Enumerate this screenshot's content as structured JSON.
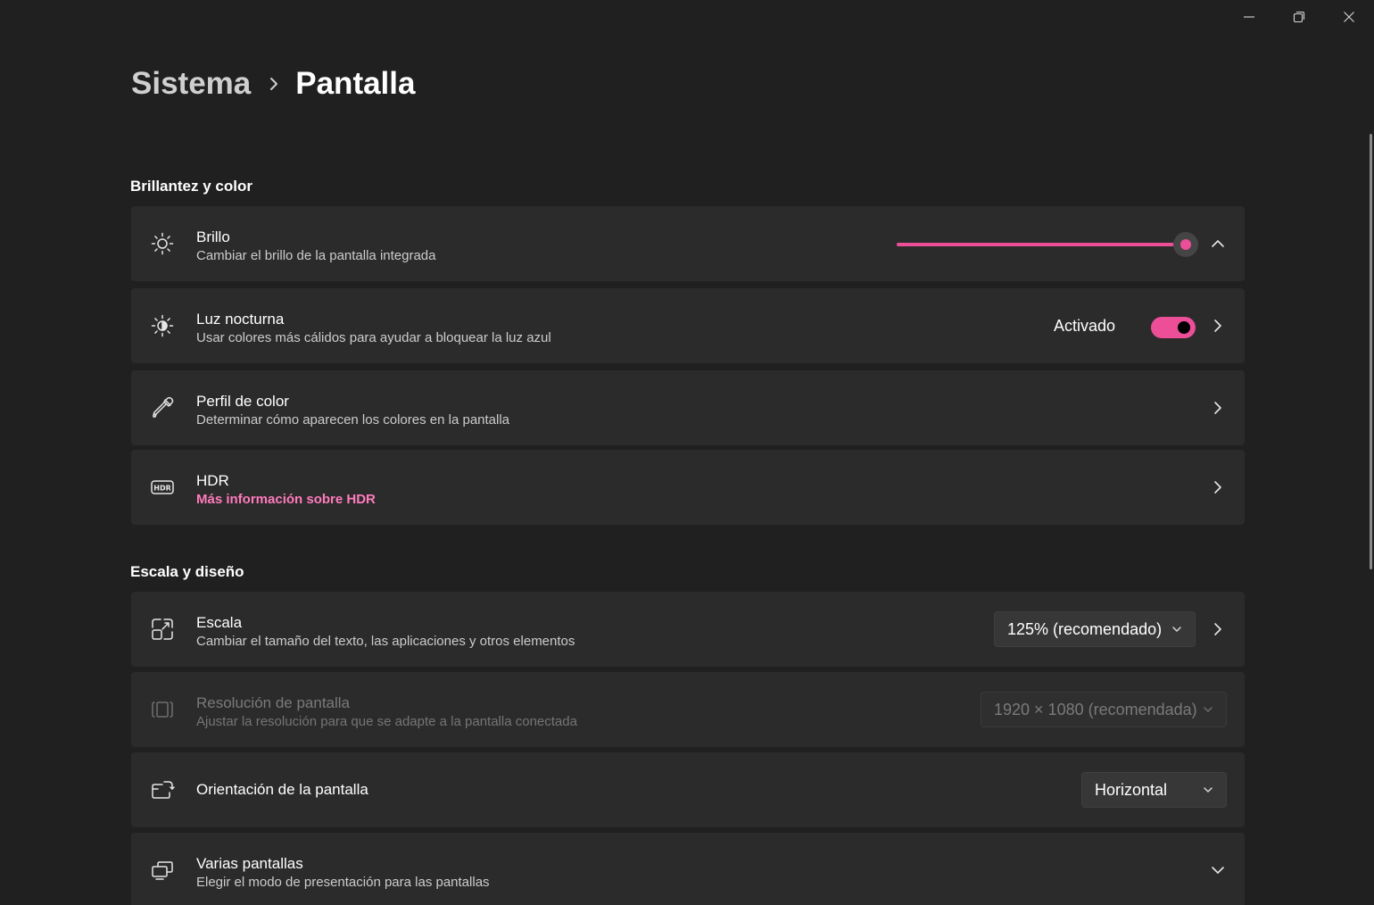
{
  "window": {
    "controls": {
      "minimize": "minimize-icon",
      "restore": "restore-icon",
      "close": "close-icon"
    }
  },
  "breadcrumb": {
    "parent": "Sistema",
    "current": "Pantalla"
  },
  "sections": {
    "brightness_color": "Brillantez y color",
    "scale_layout": "Escala y diseño"
  },
  "cards": {
    "brightness": {
      "title": "Brillo",
      "subtitle": "Cambiar el brillo de la pantalla integrada",
      "level_percent": 100,
      "icon": "sun-icon"
    },
    "night_light": {
      "title": "Luz nocturna",
      "subtitle": "Usar colores más cálidos para ayudar a bloquear la luz azul",
      "state_label": "Activado",
      "enabled": true,
      "icon": "night-light-icon"
    },
    "color_profile": {
      "title": "Perfil de color",
      "subtitle": "Determinar cómo aparecen los colores en la pantalla",
      "icon": "eyedropper-icon"
    },
    "hdr": {
      "title": "HDR",
      "link": "Más información sobre HDR",
      "icon": "hdr-icon"
    },
    "scale": {
      "title": "Escala",
      "subtitle": "Cambiar el tamaño del texto, las aplicaciones y otros elementos",
      "value": "125% (recomendado)",
      "icon": "scale-icon"
    },
    "resolution": {
      "title": "Resolución de pantalla",
      "subtitle": "Ajustar la resolución para que se adapte a la pantalla conectada",
      "value": "1920 × 1080 (recomendada)",
      "icon": "resolution-icon"
    },
    "orientation": {
      "title": "Orientación de la pantalla",
      "value": "Horizontal",
      "icon": "orientation-icon"
    },
    "multiple_displays": {
      "title": "Varias pantallas",
      "subtitle": "Elegir el modo de presentación para las pantallas",
      "icon": "multiple-displays-icon"
    }
  },
  "colors": {
    "accent": "#ec4e97",
    "link": "#ff7bbd",
    "background": "#202020",
    "card": "#2b2b2b"
  }
}
